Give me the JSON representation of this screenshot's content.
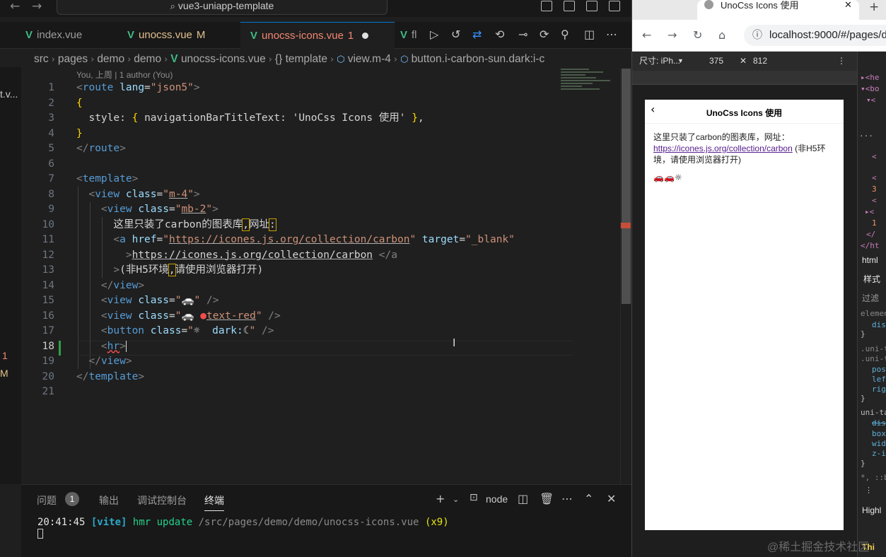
{
  "window": {
    "title": "vue3-uniapp-template"
  },
  "tabs": [
    {
      "name": "index.vue",
      "status": "",
      "modified_color": "#cccccc"
    },
    {
      "name": "unocss.vue",
      "status": "M",
      "modified_color": "#e2c08d"
    },
    {
      "name": "unocss-icons.vue",
      "status": "1",
      "modified_color": "#f48771"
    },
    {
      "name": "fl",
      "status": "",
      "modified_color": "#cccccc"
    }
  ],
  "breadcrumb": [
    "src",
    "pages",
    "demo",
    "demo",
    "unocss-icons.vue",
    "template",
    "view.m-4",
    "button.i-carbon-sun.dark:i-c"
  ],
  "blame": "You, 上周 | 1 author (You)",
  "left_strip": {
    "left_label": "t.v...",
    "count": "1",
    "mod": "M"
  },
  "code_lines": [
    {
      "n": "1"
    },
    {
      "n": "2"
    },
    {
      "n": "3"
    },
    {
      "n": "4"
    },
    {
      "n": "5"
    },
    {
      "n": "6"
    },
    {
      "n": "7"
    },
    {
      "n": "8"
    },
    {
      "n": "9"
    },
    {
      "n": "10"
    },
    {
      "n": "11"
    },
    {
      "n": "12"
    },
    {
      "n": "13"
    },
    {
      "n": "14"
    },
    {
      "n": "15"
    },
    {
      "n": "16"
    },
    {
      "n": "17"
    },
    {
      "n": "18"
    },
    {
      "n": "19"
    },
    {
      "n": "20"
    },
    {
      "n": "21"
    }
  ],
  "code": {
    "l1": {
      "tag": "route",
      "attr": "lang",
      "val": "json5"
    },
    "l3": {
      "key": "style",
      "prop": "navigationBarTitleText",
      "val": "'UnoCss Icons 使用'"
    },
    "l8": {
      "tag": "view",
      "attr": "class",
      "val": "m-4"
    },
    "l9": {
      "tag": "view",
      "attr": "class",
      "val": "mb-2"
    },
    "l10": {
      "text_a": "这里只装了carbon的图表库",
      "text_b": "网址",
      "punct_a": ",",
      "punct_b": ":"
    },
    "l11": {
      "tag": "a",
      "attr": "href",
      "val": "https://icones.js.org/collection/carbon",
      "attr2": "target",
      "val2": "_blank"
    },
    "l12": {
      "text": "https://icones.js.org/collection/carbon",
      "close": "</a"
    },
    "l13": {
      "text_a": "(非H5环境",
      "text_b": "请使用浏览器打开)",
      "punct": ","
    },
    "l14": {
      "tag": "view"
    },
    "l15": {
      "tag": "view",
      "attr": "class",
      "icon": "🚗"
    },
    "l16": {
      "tag": "view",
      "attr": "class",
      "icon": "🚗",
      "val": "text-red"
    },
    "l17": {
      "tag": "button",
      "attr": "class",
      "sun": "☼",
      "dark": "dark:",
      "moon": "☾"
    },
    "l18": {
      "tag": "hr"
    },
    "l19": {
      "tag": "view"
    },
    "l20": {
      "tag": "template"
    }
  },
  "panel": {
    "tabs": [
      "问题",
      "输出",
      "调试控制台",
      "终端"
    ],
    "problem_count": "1",
    "shell": "node",
    "terminal": {
      "time": "20:41:45",
      "vite": "[vite]",
      "msg": "hmr update",
      "path": "/src/pages/demo/demo/unocss-icons.vue",
      "count": "(x9)"
    }
  },
  "browser": {
    "tab_title": "UnoCss Icons 使用",
    "url": "localhost:9000/#/pages/d",
    "device_label": "尺寸: iPh...",
    "width": "375",
    "height": "812",
    "page_title": "UnoCss Icons 使用",
    "body_text": "这里只装了carbon的图表库，网址：",
    "link": "https://icones.js.org/collection/carbon",
    "note": "(非H5环境，请使用浏览器打开)",
    "icons": "🚗🚗☼"
  },
  "devtools": {
    "lines": [
      "▸<he",
      "▾<bo",
      "▾<",
      "...",
      "<",
      "<",
      "3",
      "<",
      "▸<",
      "1",
      "</",
      "</ht",
      "html",
      "样式",
      "过滤",
      "elemen",
      "dis",
      "}",
      ".uni-t",
      ".uni-t",
      "pos",
      "lef",
      "rig",
      "}",
      "uni-ta",
      "dis",
      "box",
      "wid",
      "z-i",
      "}",
      "*, ::b",
      "⋮",
      "Highl",
      "Thi"
    ]
  },
  "watermark": "@稀土掘金技术社区"
}
